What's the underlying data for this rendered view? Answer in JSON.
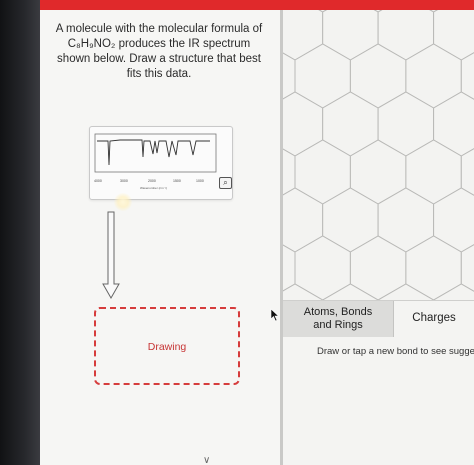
{
  "question": {
    "line1": "A molecule with the molecular formula of",
    "line2": "C₈H₉NO₂ produces the IR spectrum",
    "line3": "shown below. Draw a structure that best",
    "line4": "fits this data."
  },
  "spectrum": {
    "x_ticks": [
      "4000",
      "3000",
      "2000",
      "1500",
      "1000"
    ],
    "x_label": "Wavenumber (cm⁻¹)"
  },
  "drawing_box": {
    "label": "Drawing"
  },
  "tools": {
    "tab_atoms_line1": "Atoms, Bonds",
    "tab_atoms_line2": "and Rings",
    "tab_charges": "Charges"
  },
  "hint_text": "Draw or tap a new bond to see sugge",
  "colors": {
    "accent_red": "#e0292b",
    "dashed_border": "#d63c3c",
    "hex_grid_stroke": "#b9b9b7"
  },
  "icons": {
    "zoom": "magnifier-icon",
    "arrow": "down-arrow-icon",
    "cursor": "mouse-pointer-icon",
    "chevron": "chevron-down-icon"
  }
}
